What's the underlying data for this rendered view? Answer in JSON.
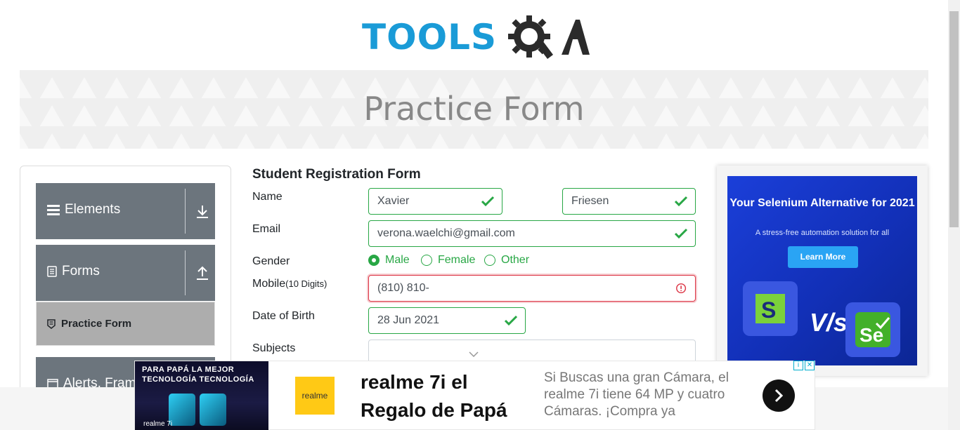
{
  "logo": {
    "text": "TOOLS",
    "suffix": "A",
    "brand_color": "#1a9bd7"
  },
  "banner": {
    "title": "Practice Form"
  },
  "sidebar": {
    "groups": [
      {
        "label": "Elements",
        "icon": "list-icon",
        "arrow": "download-arrow-icon"
      },
      {
        "label": "Forms",
        "icon": "document-icon",
        "arrow": "upload-arrow-icon"
      },
      {
        "label": "Alerts, Fram",
        "icon": "window-icon"
      }
    ],
    "active_item": {
      "label": "Practice Form",
      "icon": "badge-icon"
    }
  },
  "form": {
    "title": "Student Registration Form",
    "name_label": "Name",
    "first_name": "Xavier",
    "last_name": "Friesen",
    "email_label": "Email",
    "email": "verona.waelchi@gmail.com",
    "gender_label": "Gender",
    "gender_options": [
      "Male",
      "Female",
      "Other"
    ],
    "gender_selected": "Male",
    "mobile_label": "Mobile",
    "mobile_hint": "(10 Digits)",
    "mobile": "(810) 810-",
    "dob_label": "Date of Birth",
    "dob": "28 Jun 2021",
    "subjects_label": "Subjects",
    "valid_color": "#28a745",
    "error_color": "#dc3545"
  },
  "side_ad": {
    "headline": "Your Selenium Alternative for 2021",
    "sub": "A stress-free automation solution for all",
    "button": "Learn More",
    "vs": "V/s"
  },
  "bottom_ad": {
    "thumb_headline": "PARA PAPÁ LA MEJOR TECNOLOGÍA TECNOLOGÍA",
    "thumb_brand": "realme 7i",
    "logo": "realme",
    "headline": "realme 7i el Regalo de Papá",
    "description": "Si Buscas una gran Cámara, el realme 7i tiene 64 MP y cuatro Cámaras. ¡Compra ya"
  }
}
